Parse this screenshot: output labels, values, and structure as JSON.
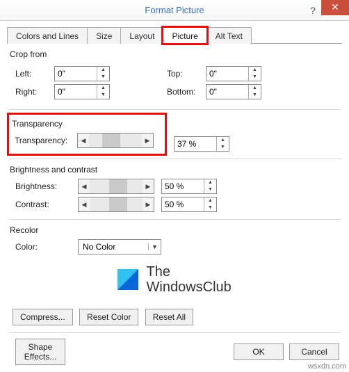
{
  "title": "Format Picture",
  "tabs": {
    "colors_lines": "Colors and Lines",
    "size": "Size",
    "layout": "Layout",
    "picture": "Picture",
    "alt_text": "Alt Text"
  },
  "crop": {
    "section": "Crop from",
    "left_label": "Left:",
    "right_label": "Right:",
    "top_label": "Top:",
    "bottom_label": "Bottom:",
    "left_value": "0\"",
    "right_value": "0\"",
    "top_value": "0\"",
    "bottom_value": "0\""
  },
  "transparency": {
    "section": "Transparency",
    "label": "Transparency:",
    "value": "37 %"
  },
  "brightness_contrast": {
    "section": "Brightness and contrast",
    "brightness_label": "Brightness:",
    "brightness_value": "50 %",
    "contrast_label": "Contrast:",
    "contrast_value": "50 %"
  },
  "recolor": {
    "section": "Recolor",
    "color_label": "Color:",
    "color_value": "No Color"
  },
  "logo": {
    "line1": "The",
    "line2": "WindowsClub"
  },
  "buttons": {
    "compress": "Compress...",
    "reset_color": "Reset Color",
    "reset_all": "Reset All",
    "shape_effects": "Shape Effects...",
    "ok": "OK",
    "cancel": "Cancel"
  },
  "watermark": "wsxdn.com"
}
